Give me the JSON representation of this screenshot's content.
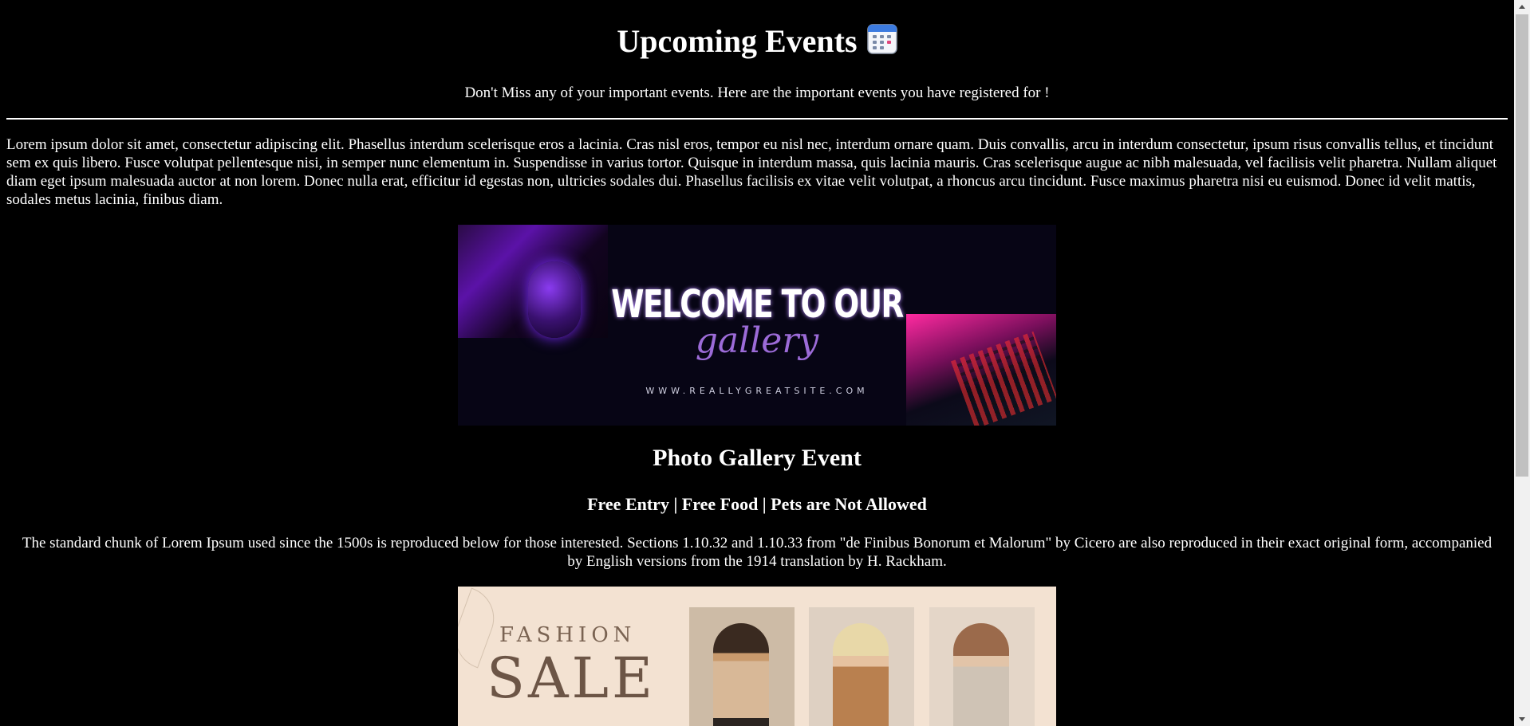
{
  "header": {
    "title": "Upcoming Events",
    "title_icon": "calendar-icon",
    "subtitle": "Don't Miss any of your important events. Here are the important events you have registered for !"
  },
  "intro": "Lorem ipsum dolor sit amet, consectetur adipiscing elit. Phasellus interdum scelerisque eros a lacinia. Cras nisl eros, tempor eu nisl nec, interdum ornare quam. Duis convallis, arcu in interdum consectetur, ipsum risus convallis tellus, et tincidunt sem ex quis libero. Fusce volutpat pellentesque nisi, in semper nunc elementum in. Suspendisse in varius tortor. Quisque in interdum massa, quis lacinia mauris. Cras scelerisque augue ac nibh malesuada, vel facilisis velit pharetra. Nullam aliquet diam eget ipsum malesuada auctor at non lorem. Donec nulla erat, efficitur id egestas non, ultricies sodales dui. Phasellus facilisis ex vitae velit volutpat, a rhoncus arcu tincidunt. Fusce maximus pharetra nisi eu euismod. Donec id velit mattis, sodales metus lacinia, finibus diam.",
  "events": [
    {
      "banner": {
        "headline": "WELCOME TO OUR",
        "script_text": "gallery",
        "url": "WWW.REALLYGREATSITE.COM"
      },
      "title": "Photo Gallery Event",
      "tags": "Free Entry | Free Food | Pets are Not Allowed",
      "description": "The standard chunk of Lorem Ipsum used since the 1500s is reproduced below for those interested. Sections 1.10.32 and 1.10.33 from \"de Finibus Bonorum et Malorum\" by Cicero are also reproduced in their exact original form, accompanied by English versions from the 1914 translation by H. Rackham."
    },
    {
      "banner": {
        "headline_small": "FASHION",
        "headline_large": "SALE"
      }
    }
  ],
  "colors": {
    "background": "#000000",
    "text": "#ffffff",
    "scrollbar_track": "#f1f1f1",
    "scrollbar_thumb": "#c1c1c1"
  }
}
